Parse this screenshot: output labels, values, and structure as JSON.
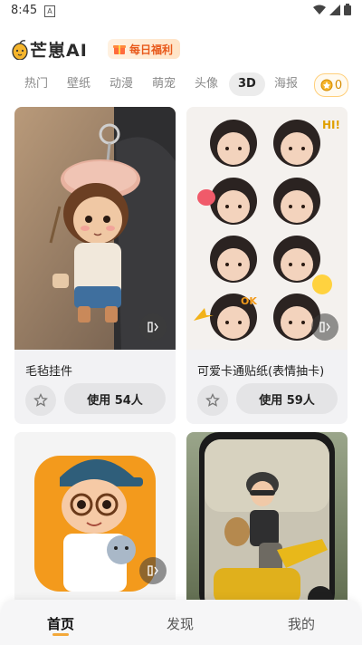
{
  "status_bar": {
    "time": "8:45",
    "notification_letter": "A"
  },
  "header": {
    "app_name": "芒崽AI",
    "daily_badge": "每日福利"
  },
  "tabs": [
    {
      "label": "热门"
    },
    {
      "label": "壁纸"
    },
    {
      "label": "动漫"
    },
    {
      "label": "萌宠"
    },
    {
      "label": "头像"
    },
    {
      "label": "3D",
      "active": true
    },
    {
      "label": "海报"
    }
  ],
  "coins": {
    "count": "0"
  },
  "cards": [
    {
      "title": "毛毡挂件",
      "use_label": "使用 54人"
    },
    {
      "title": "可爱卡通贴纸(表情抽卡)",
      "use_label": "使用 59人"
    },
    {
      "title": "",
      "use_label": ""
    },
    {
      "title": "",
      "use_label": ""
    }
  ],
  "bottom_nav": [
    {
      "label": "首页",
      "active": true
    },
    {
      "label": "发现"
    },
    {
      "label": "我的"
    }
  ],
  "colors": {
    "accent": "#f3a83b",
    "badge_text": "#e8591b",
    "card_bg": "#f2f2f4",
    "button_bg": "#e4e4e6"
  }
}
